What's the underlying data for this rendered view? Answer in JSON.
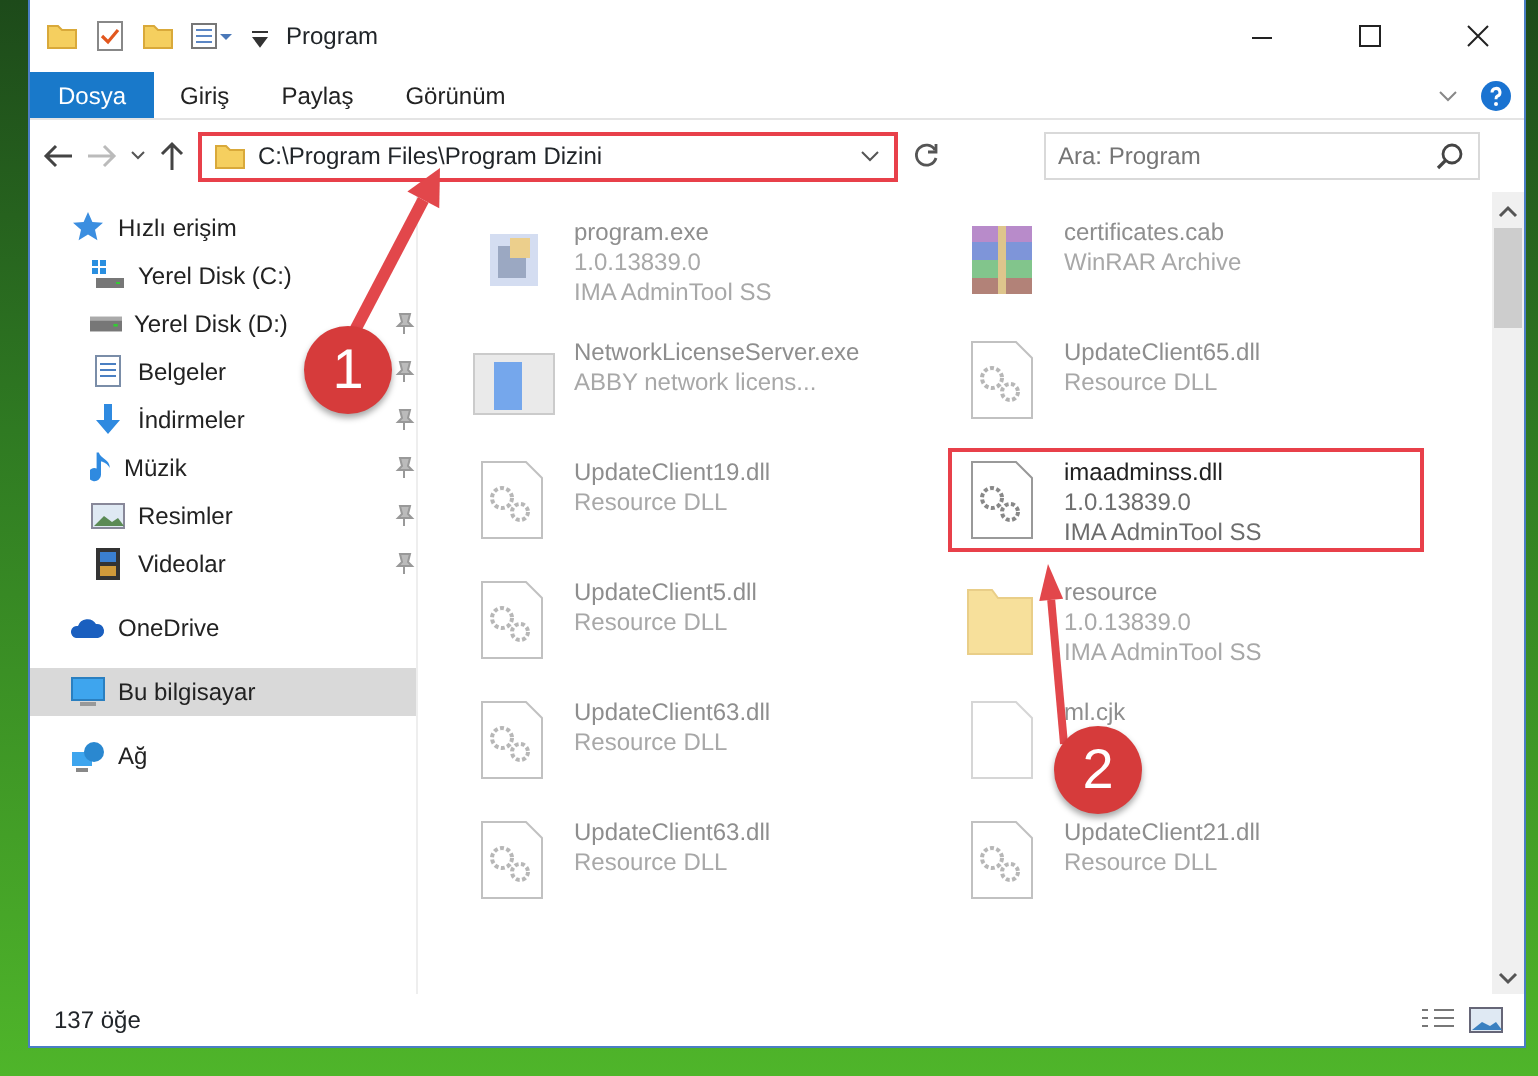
{
  "window": {
    "title": "Program"
  },
  "ribbon_tabs": [
    {
      "label": "Dosya",
      "selected": true
    },
    {
      "label": "Giriş",
      "selected": false
    },
    {
      "label": "Paylaş",
      "selected": false
    },
    {
      "label": "Görünüm",
      "selected": false
    }
  ],
  "address_bar": {
    "path": "C:\\Program Files\\Program Dizini",
    "highlighted": true
  },
  "search": {
    "placeholder": "Ara: Program"
  },
  "navigation": [
    {
      "label": "Hızlı erişim",
      "kind": "star",
      "pinned": false,
      "selected": false,
      "children": [
        {
          "label": "Yerel Disk (C:)",
          "kind": "windrive",
          "pinned": false,
          "selected": false
        },
        {
          "label": "Yerel Disk (D:)",
          "kind": "drive",
          "pinned": true,
          "selected": false
        },
        {
          "label": "Belgeler",
          "kind": "docs",
          "pinned": true,
          "selected": false
        },
        {
          "label": "İndirmeler",
          "kind": "download",
          "pinned": true,
          "selected": false
        },
        {
          "label": "Müzik",
          "kind": "music",
          "pinned": true,
          "selected": false
        },
        {
          "label": "Resimler",
          "kind": "pictures",
          "pinned": true,
          "selected": false
        },
        {
          "label": "Videolar",
          "kind": "video",
          "pinned": true,
          "selected": false
        }
      ]
    },
    {
      "label": "OneDrive",
      "kind": "cloud",
      "pinned": false,
      "selected": false
    },
    {
      "label": "Bu bilgisayar",
      "kind": "pc",
      "pinned": false,
      "selected": true
    },
    {
      "label": "Ağ",
      "kind": "network",
      "pinned": false,
      "selected": false
    }
  ],
  "files": [
    {
      "name": "program.exe",
      "details": [
        "1.0.13839.0",
        "IMA AdminTool SS"
      ],
      "kind": "exe",
      "faded": true,
      "highlighted": false
    },
    {
      "name": "certificates.cab",
      "details": [
        "WinRAR Archive"
      ],
      "kind": "cab",
      "faded": true,
      "highlighted": false
    },
    {
      "name": "NetworkLicenseServer.exe",
      "details": [
        "ABBY network licens..."
      ],
      "kind": "app",
      "faded": true,
      "highlighted": false
    },
    {
      "name": "UpdateClient65.dll",
      "details": [
        "Resource DLL"
      ],
      "kind": "dll",
      "faded": true,
      "highlighted": false
    },
    {
      "name": "UpdateClient19.dll",
      "details": [
        "Resource DLL"
      ],
      "kind": "dll",
      "faded": true,
      "highlighted": false
    },
    {
      "name": "imaadminss.dll",
      "details": [
        "1.0.13839.0",
        "IMA AdminTool SS"
      ],
      "kind": "dll",
      "faded": false,
      "highlighted": true
    },
    {
      "name": "UpdateClient5.dll",
      "details": [
        "Resource DLL"
      ],
      "kind": "dll",
      "faded": true,
      "highlighted": false
    },
    {
      "name": "resource",
      "details": [
        "1.0.13839.0",
        "IMA AdminTool SS"
      ],
      "kind": "folder",
      "faded": true,
      "highlighted": false
    },
    {
      "name": "UpdateClient63.dll",
      "details": [
        "Resource DLL"
      ],
      "kind": "dll",
      "faded": true,
      "highlighted": false
    },
    {
      "name": "ml.cjk",
      "kind": "blank",
      "faded": true,
      "highlighted": false
    },
    {
      "name": "UpdateClient63.dll",
      "details": [
        "Resource DLL"
      ],
      "kind": "dll",
      "faded": true,
      "highlighted": false
    },
    {
      "name": "UpdateClient21.dll",
      "details": [
        "Resource DLL"
      ],
      "kind": "dll",
      "faded": true,
      "highlighted": false
    }
  ],
  "status_bar": {
    "count": "137 öğe"
  },
  "annotations": [
    {
      "number": "1"
    },
    {
      "number": "2"
    }
  ]
}
